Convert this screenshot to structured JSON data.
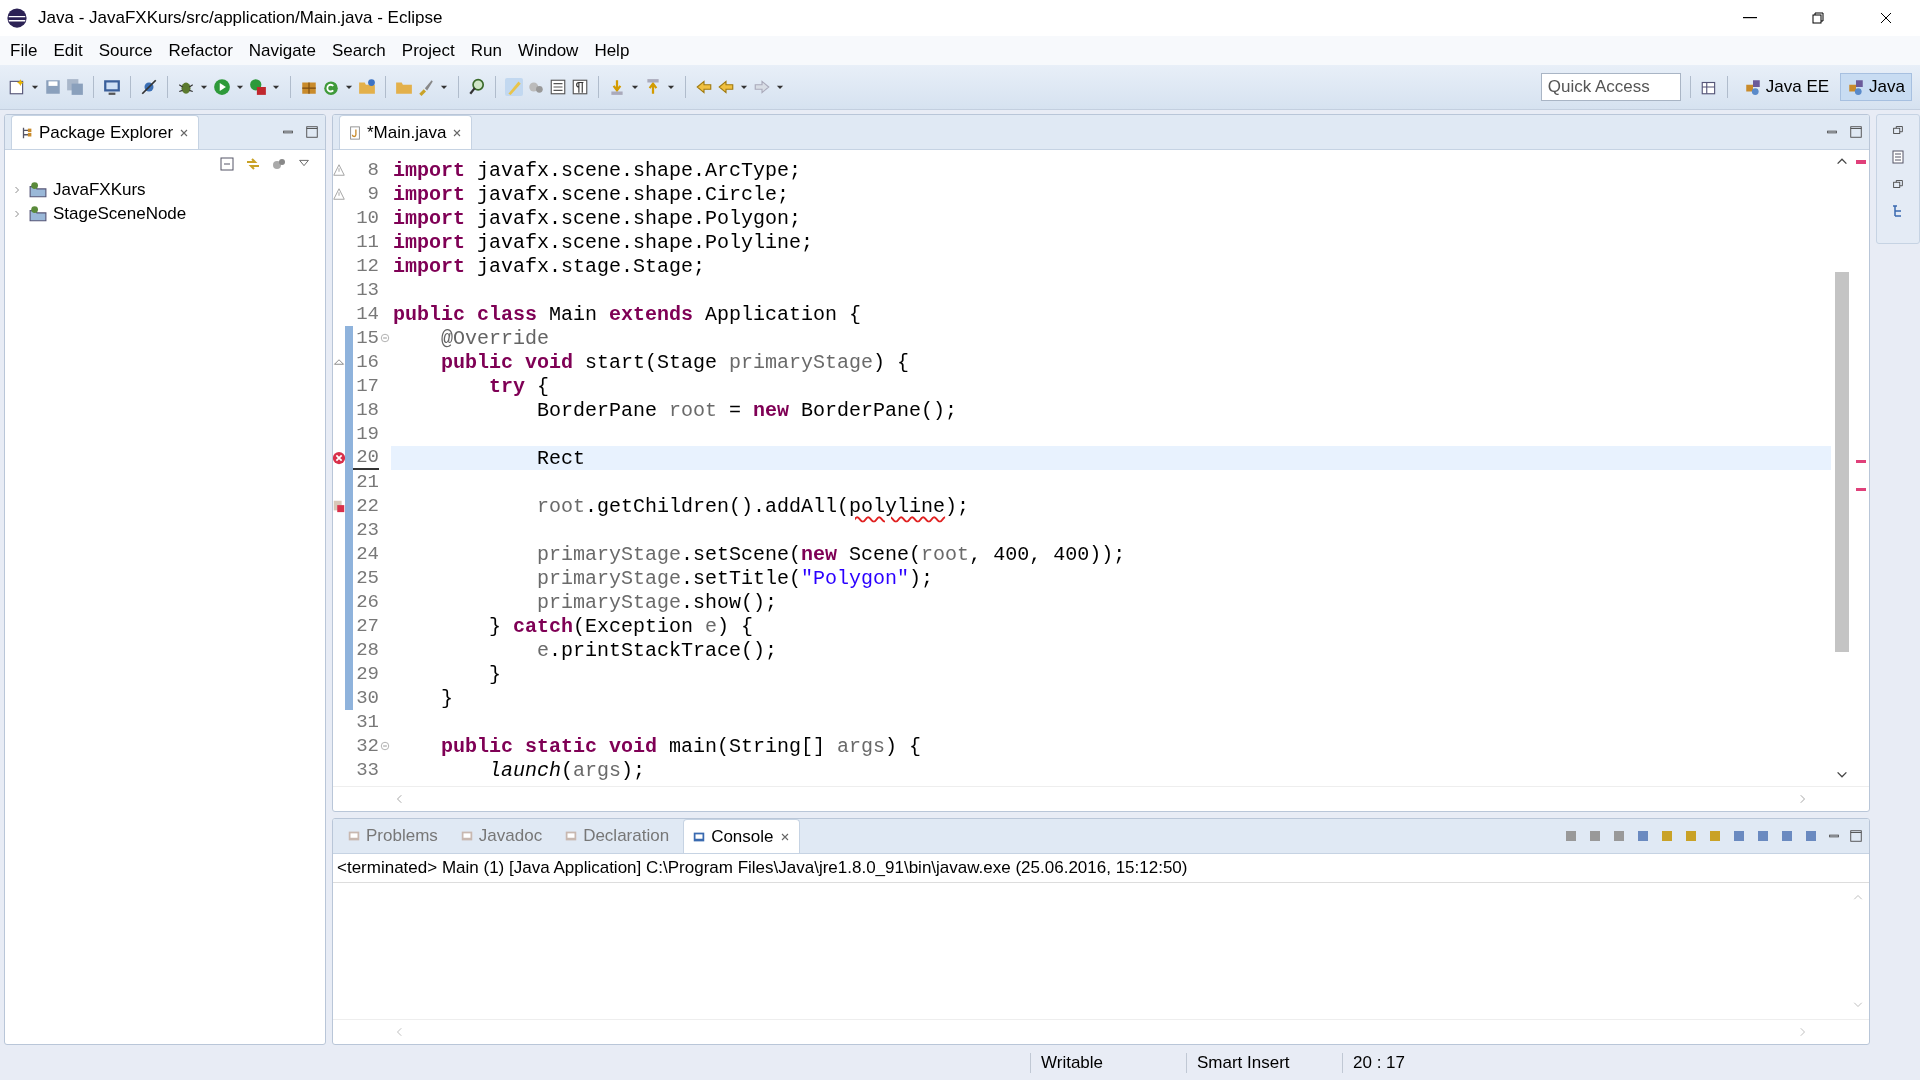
{
  "window": {
    "title": "Java - JavaFXKurs/src/application/Main.java - Eclipse"
  },
  "menu": [
    "File",
    "Edit",
    "Source",
    "Refactor",
    "Navigate",
    "Search",
    "Project",
    "Run",
    "Window",
    "Help"
  ],
  "quick_access": {
    "placeholder": "Quick Access"
  },
  "perspectives": [
    {
      "label": "Java EE",
      "selected": false
    },
    {
      "label": "Java",
      "selected": true
    }
  ],
  "package_explorer": {
    "title": "Package Explorer",
    "items": [
      {
        "label": "JavaFXKurs",
        "expanded": false
      },
      {
        "label": "StageSceneNode",
        "expanded": false
      }
    ]
  },
  "editor": {
    "tab": {
      "label": "*Main.java",
      "selected": true
    },
    "lines": [
      {
        "number": "8",
        "kind": "warning",
        "changed": false,
        "current": false,
        "tokens": [
          {
            "kind": "kw",
            "text": "import"
          },
          {
            "kind": "text",
            "text": " javafx.scene.shape.ArcType;"
          }
        ]
      },
      {
        "number": "9",
        "kind": "warning",
        "changed": false,
        "current": false,
        "tokens": [
          {
            "kind": "kw",
            "text": "import"
          },
          {
            "kind": "text",
            "text": " javafx.scene.shape.Circle;"
          }
        ]
      },
      {
        "number": "10",
        "changed": false,
        "current": false,
        "tokens": [
          {
            "kind": "kw",
            "text": "import"
          },
          {
            "kind": "text",
            "text": " javafx.scene.shape.Polygon;"
          }
        ]
      },
      {
        "number": "11",
        "changed": false,
        "current": false,
        "tokens": [
          {
            "kind": "kw",
            "text": "import"
          },
          {
            "kind": "text",
            "text": " javafx.scene.shape.Polyline;"
          }
        ]
      },
      {
        "number": "12",
        "changed": false,
        "current": false,
        "tokens": [
          {
            "kind": "kw",
            "text": "import"
          },
          {
            "kind": "text",
            "text": " javafx.stage.Stage;"
          }
        ]
      },
      {
        "number": "13",
        "changed": false,
        "current": false
      },
      {
        "number": "14",
        "changed": false,
        "current": false,
        "tokens": [
          {
            "kind": "kw",
            "text": "public class"
          },
          {
            "kind": "text",
            "text": " Main "
          },
          {
            "kind": "kw",
            "text": "extends"
          },
          {
            "kind": "text",
            "text": " Application {"
          }
        ]
      },
      {
        "number": "15",
        "kind": "fold",
        "changed": true,
        "current": false,
        "tokens": [
          {
            "kind": "annot",
            "text": "    @Override"
          }
        ]
      },
      {
        "number": "16",
        "kind": "override",
        "changed": true,
        "current": false,
        "tokens": [
          {
            "kind": "kw",
            "text": "    public void"
          },
          {
            "kind": "text",
            "text": " start(Stage "
          },
          {
            "kind": "var",
            "text": "primaryStage"
          },
          {
            "kind": "text",
            "text": ") {"
          }
        ]
      },
      {
        "number": "17",
        "changed": true,
        "current": false,
        "tokens": [
          {
            "kind": "kw",
            "text": "        try"
          },
          {
            "kind": "text",
            "text": " {"
          }
        ]
      },
      {
        "number": "18",
        "changed": true,
        "current": false,
        "tokens": [
          {
            "kind": "text",
            "text": "            BorderPane "
          },
          {
            "kind": "var",
            "text": "root"
          },
          {
            "kind": "text",
            "text": " = "
          },
          {
            "kind": "kw",
            "text": "new"
          },
          {
            "kind": "text",
            "text": " BorderPane();"
          }
        ]
      },
      {
        "number": "19",
        "changed": true,
        "current": false
      },
      {
        "number": "20",
        "kind": "error",
        "changed": true,
        "current": true,
        "tokens": [
          {
            "kind": "text",
            "text": "            Rect"
          }
        ]
      },
      {
        "number": "21",
        "changed": true,
        "current": false
      },
      {
        "number": "22",
        "kind": "error-task",
        "changed": true,
        "current": false,
        "tokens": [
          {
            "kind": "var",
            "text": "            root"
          },
          {
            "kind": "text",
            "text": ".getChildren().addAll("
          },
          {
            "kind": "error",
            "text": "polyline"
          },
          {
            "kind": "text",
            "text": ");"
          }
        ]
      },
      {
        "number": "23",
        "changed": true,
        "current": false
      },
      {
        "number": "24",
        "changed": true,
        "current": false,
        "tokens": [
          {
            "kind": "var",
            "text": "            primaryStage"
          },
          {
            "kind": "text",
            "text": ".setScene("
          },
          {
            "kind": "kw",
            "text": "new"
          },
          {
            "kind": "text",
            "text": " Scene("
          },
          {
            "kind": "var",
            "text": "root"
          },
          {
            "kind": "text",
            "text": ", 400, 400));"
          }
        ]
      },
      {
        "number": "25",
        "changed": true,
        "current": false,
        "tokens": [
          {
            "kind": "var",
            "text": "            primaryStage"
          },
          {
            "kind": "text",
            "text": ".setTitle("
          },
          {
            "kind": "str",
            "text": "\"Polygon\""
          },
          {
            "kind": "text",
            "text": ");"
          }
        ]
      },
      {
        "number": "26",
        "changed": true,
        "current": false,
        "tokens": [
          {
            "kind": "var",
            "text": "            primaryStage"
          },
          {
            "kind": "text",
            "text": ".show();"
          }
        ]
      },
      {
        "number": "27",
        "changed": true,
        "current": false,
        "tokens": [
          {
            "kind": "text",
            "text": "        } "
          },
          {
            "kind": "kw",
            "text": "catch"
          },
          {
            "kind": "text",
            "text": "(Exception "
          },
          {
            "kind": "var",
            "text": "e"
          },
          {
            "kind": "text",
            "text": ") {"
          }
        ]
      },
      {
        "number": "28",
        "changed": true,
        "current": false,
        "tokens": [
          {
            "kind": "var",
            "text": "            e"
          },
          {
            "kind": "text",
            "text": ".printStackTrace();"
          }
        ]
      },
      {
        "number": "29",
        "changed": true,
        "current": false,
        "tokens": [
          {
            "kind": "text",
            "text": "        }"
          }
        ]
      },
      {
        "number": "30",
        "changed": true,
        "current": false,
        "tokens": [
          {
            "kind": "text",
            "text": "    }"
          }
        ]
      },
      {
        "number": "31",
        "changed": false,
        "current": false
      },
      {
        "number": "32",
        "kind": "fold",
        "changed": false,
        "current": false,
        "tokens": [
          {
            "kind": "kw",
            "text": "    public static void"
          },
          {
            "kind": "text",
            "text": " main(String[] "
          },
          {
            "kind": "var",
            "text": "args"
          },
          {
            "kind": "text",
            "text": ") {"
          }
        ]
      },
      {
        "number": "33",
        "changed": false,
        "current": false,
        "tokens": [
          {
            "kind": "static",
            "text": "        launch"
          },
          {
            "kind": "text",
            "text": "("
          },
          {
            "kind": "var",
            "text": "args"
          },
          {
            "kind": "text",
            "text": ");"
          }
        ]
      }
    ]
  },
  "bottom_tabs": [
    {
      "label": "Problems",
      "selected": false
    },
    {
      "label": "Javadoc",
      "selected": false
    },
    {
      "label": "Declaration",
      "selected": false
    },
    {
      "label": "Console",
      "selected": true
    }
  ],
  "console": {
    "header": "<terminated> Main (1) [Java Application] C:\\Program Files\\Java\\jre1.8.0_91\\bin\\javaw.exe (25.06.2016, 15:12:50)"
  },
  "status_bar": [
    "Writable",
    "Smart Insert",
    "20 : 17"
  ]
}
